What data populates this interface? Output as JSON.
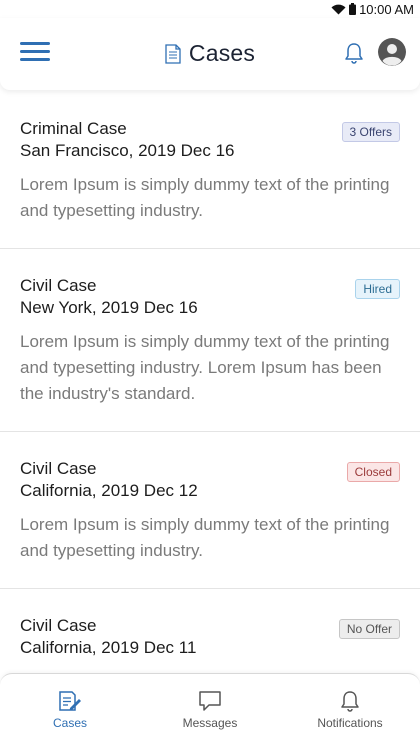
{
  "status_bar": {
    "time": "10:00 AM"
  },
  "header": {
    "title": "Cases"
  },
  "cases": [
    {
      "type": "Criminal Case",
      "location": "San Francisco, 2019 Dec 16",
      "description": "Lorem Ipsum is simply dummy text of the printing and typesetting industry.",
      "badge": "3 Offers"
    },
    {
      "type": "Civil Case",
      "location": "New York, 2019 Dec 16",
      "description": "Lorem Ipsum is simply dummy text of the printing and typesetting industry. Lorem Ipsum has been the industry's standard.",
      "badge": "Hired"
    },
    {
      "type": "Civil Case",
      "location": "California, 2019 Dec 12",
      "description": "Lorem Ipsum is simply dummy text of the printing and typesetting industry.",
      "badge": "Closed"
    },
    {
      "type": "Civil Case",
      "location": "California, 2019 Dec 11",
      "description": "",
      "badge": "No Offer"
    }
  ],
  "bottom_nav": [
    {
      "label": "Cases",
      "icon": "cases-icon",
      "active": true
    },
    {
      "label": "Messages",
      "icon": "message-icon",
      "active": false
    },
    {
      "label": "Notifications",
      "icon": "bell-icon",
      "active": false
    }
  ],
  "colors": {
    "accent": "#2f6fb3"
  }
}
